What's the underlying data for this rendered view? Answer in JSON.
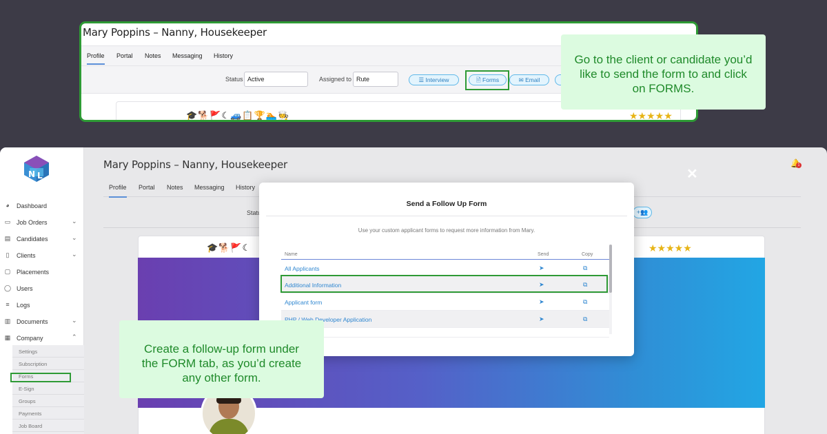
{
  "top_panel": {
    "title": "Mary Poppins – Nanny, Housekeeper",
    "tabs": [
      "Profile",
      "Portal",
      "Notes",
      "Messaging",
      "History"
    ],
    "status_label": "Status",
    "status_value": "Active",
    "assigned_label": "Assigned to",
    "assigned_value": "Rute",
    "buttons": {
      "interview": "☰ Interview",
      "forms": "🗎 Forms",
      "email": "✉ Email"
    },
    "skill_icons": "🎓🐕🚩☾🚙📋🏆🏊🧑‍🍳",
    "rating": "★★★★★"
  },
  "callouts": {
    "top": "Go to the client or candidate you’d like to send the form to and click on FORMS.",
    "bottom": "Create a follow-up form under the FORM tab, as you’d create any other form."
  },
  "app": {
    "title": "Mary Poppins – Nanny, Housekeeper",
    "tabs": [
      "Profile",
      "Portal",
      "Notes",
      "Messaging",
      "History"
    ],
    "status_partial": "Statu",
    "notification_count": "1",
    "partial_button": "+👥",
    "skill_icons": "🎓🐕🚩☾",
    "rating": "★★★★★",
    "close_symbol": "✕",
    "sidebar": {
      "items": [
        {
          "label": "Dashboard",
          "icon": "dashboard-icon",
          "glyph": "◕",
          "chevron": ""
        },
        {
          "label": "Job Orders",
          "icon": "clipboard-icon",
          "glyph": "▭",
          "chevron": "⌄"
        },
        {
          "label": "Candidates",
          "icon": "id-card-icon",
          "glyph": "▤",
          "chevron": "⌄"
        },
        {
          "label": "Clients",
          "icon": "building-icon",
          "glyph": "▯",
          "chevron": "⌄"
        },
        {
          "label": "Placements",
          "icon": "folder-icon",
          "glyph": "▢",
          "chevron": ""
        },
        {
          "label": "Users",
          "icon": "user-icon",
          "glyph": "◯",
          "chevron": ""
        },
        {
          "label": "Logs",
          "icon": "database-icon",
          "glyph": "≡",
          "chevron": ""
        },
        {
          "label": "Documents",
          "icon": "book-icon",
          "glyph": "▥",
          "chevron": "⌄"
        },
        {
          "label": "Company",
          "icon": "company-icon",
          "glyph": "▦",
          "chevron": "⌃"
        }
      ],
      "sub_items": [
        "Settings",
        "Subscription",
        "Forms",
        "E-Sign",
        "Groups",
        "Payments",
        "Job Board"
      ]
    }
  },
  "modal": {
    "title": "Send a Follow Up Form",
    "subtitle": "Use your custom applicant forms to request more information from Mary.",
    "columns": {
      "name": "Name",
      "send": "Send",
      "copy": "Copy"
    },
    "rows": [
      {
        "name": "All Applicants"
      },
      {
        "name": "Additional Information"
      },
      {
        "name": "Applicant form"
      },
      {
        "name": "PHP / Web Developer Application"
      }
    ],
    "send_glyph": "➤",
    "copy_glyph": "⧉"
  }
}
